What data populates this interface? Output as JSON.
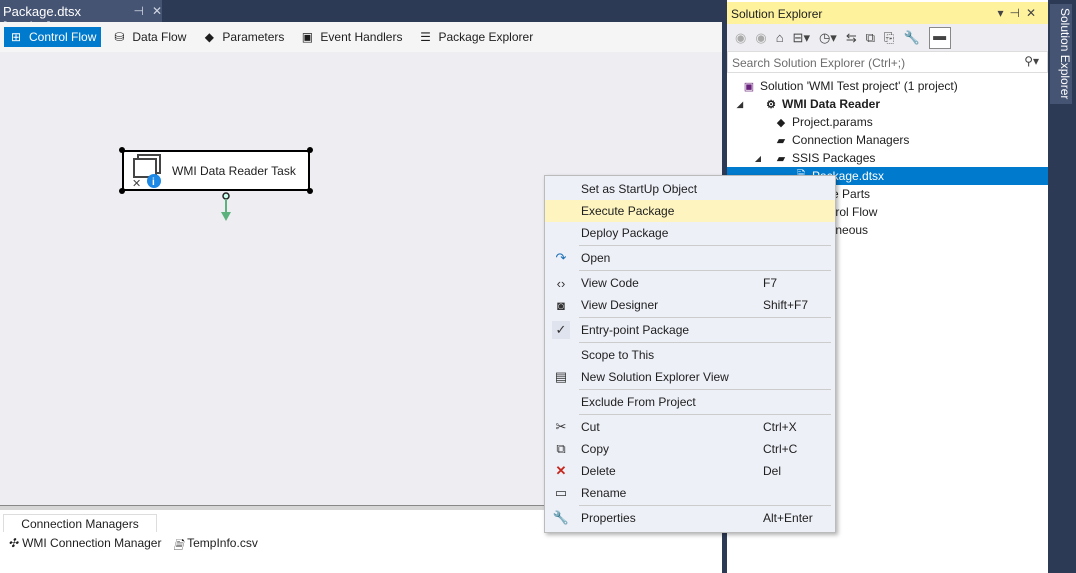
{
  "doc_tab": {
    "title": "Package.dtsx [Design]",
    "pin_icon": "pin-icon",
    "close_icon": "close-icon"
  },
  "designer_tabs": [
    {
      "label": "Control Flow",
      "icon": "control-flow-icon",
      "selected": true
    },
    {
      "label": "Data Flow",
      "icon": "data-flow-icon"
    },
    {
      "label": "Parameters",
      "icon": "parameters-icon"
    },
    {
      "label": "Event Handlers",
      "icon": "event-handlers-icon"
    },
    {
      "label": "Package Explorer",
      "icon": "package-explorer-icon"
    }
  ],
  "task": {
    "label": "WMI Data Reader Task"
  },
  "connection_managers": {
    "tab": "Connection Managers",
    "items": [
      "WMI Connection Manager",
      "TempInfo.csv"
    ]
  },
  "solution_explorer": {
    "title": "Solution Explorer",
    "search_placeholder": "Search Solution Explorer (Ctrl+;)",
    "side_label": "Solution Explorer",
    "tree": [
      "Solution 'WMI Test project' (1 project)",
      "WMI Data Reader",
      "Project.params",
      "Connection Managers",
      "SSIS Packages",
      "Package.dtsx",
      "Package Parts",
      "Control Flow",
      "Miscellaneous"
    ]
  },
  "context_menu": [
    {
      "label": "Set as StartUp Object",
      "shortcut": ""
    },
    {
      "label": "Execute Package",
      "shortcut": ""
    },
    {
      "label": "Deploy Package",
      "shortcut": ""
    },
    {
      "label": "Open",
      "shortcut": ""
    },
    {
      "label": "View Code",
      "shortcut": "F7"
    },
    {
      "label": "View Designer",
      "shortcut": "Shift+F7"
    },
    {
      "label": "Entry-point Package",
      "shortcut": ""
    },
    {
      "label": "Scope to This",
      "shortcut": ""
    },
    {
      "label": "New Solution Explorer View",
      "shortcut": ""
    },
    {
      "label": "Exclude From Project",
      "shortcut": ""
    },
    {
      "label": "Cut",
      "shortcut": "Ctrl+X"
    },
    {
      "label": "Copy",
      "shortcut": "Ctrl+C"
    },
    {
      "label": "Delete",
      "shortcut": "Del"
    },
    {
      "label": "Rename",
      "shortcut": ""
    },
    {
      "label": "Properties",
      "shortcut": "Alt+Enter"
    }
  ],
  "colors": {
    "accent": "#007acc",
    "highlight": "#fdf4bf",
    "title_yellow": "#fff29d"
  }
}
